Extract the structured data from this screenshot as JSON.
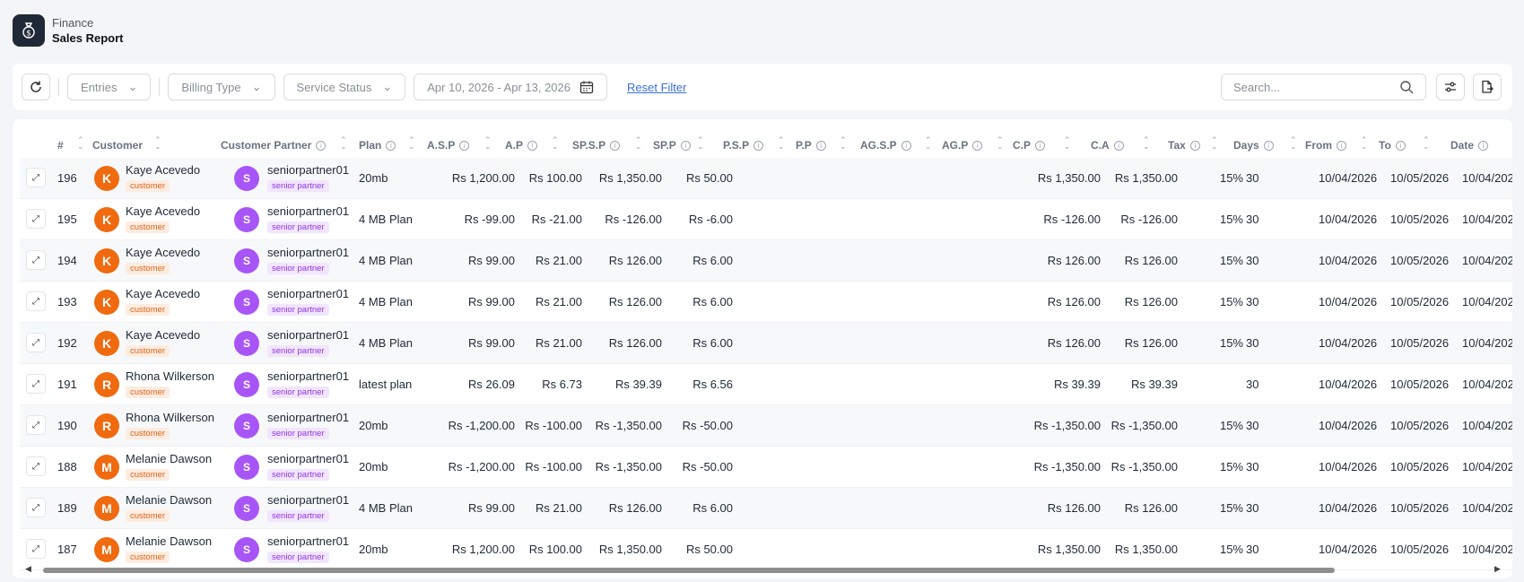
{
  "header": {
    "section": "Finance",
    "title": "Sales Report",
    "icon": "money-bag-icon"
  },
  "toolbar": {
    "entries": "Entries",
    "billing_type": "Billing Type",
    "service_status": "Service Status",
    "date_range": "Apr 10, 2026 - Apr 13, 2026",
    "reset": "Reset Filter",
    "search_placeholder": "Search..."
  },
  "columns": [
    "#",
    "Customer",
    "Customer Partner",
    "Plan",
    "A.S.P",
    "A.P",
    "SP.S.P",
    "SP.P",
    "P.S.P",
    "P.P",
    "AG.S.P",
    "AG.P",
    "C.P",
    "C.A",
    "Tax",
    "Days",
    "From",
    "To",
    "Date"
  ],
  "rows": [
    {
      "num": "196",
      "avatar": "K",
      "customer": "Kaye Acevedo",
      "ctype": "customer",
      "pavatar": "S",
      "partner": "seniorpartner01",
      "ptype": "senior partner",
      "plan": "20mb",
      "asp": "Rs 1,200.00",
      "ap": "Rs 100.00",
      "spsp": "Rs 1,350.00",
      "spp": "Rs 50.00",
      "cp": "Rs 1,350.00",
      "ca": "Rs 1,350.00",
      "tax": "15%",
      "days": "30",
      "from": "10/04/2026",
      "to": "10/05/2026",
      "date": "10/04/202"
    },
    {
      "num": "195",
      "avatar": "K",
      "customer": "Kaye Acevedo",
      "ctype": "customer",
      "pavatar": "S",
      "partner": "seniorpartner01",
      "ptype": "senior partner",
      "plan": "4 MB Plan",
      "asp": "Rs -99.00",
      "ap": "Rs -21.00",
      "spsp": "Rs -126.00",
      "spp": "Rs -6.00",
      "cp": "Rs -126.00",
      "ca": "Rs -126.00",
      "tax": "15%",
      "days": "30",
      "from": "10/04/2026",
      "to": "10/05/2026",
      "date": "10/04/202"
    },
    {
      "num": "194",
      "avatar": "K",
      "customer": "Kaye Acevedo",
      "ctype": "customer",
      "pavatar": "S",
      "partner": "seniorpartner01",
      "ptype": "senior partner",
      "plan": "4 MB Plan",
      "asp": "Rs 99.00",
      "ap": "Rs 21.00",
      "spsp": "Rs 126.00",
      "spp": "Rs 6.00",
      "cp": "Rs 126.00",
      "ca": "Rs 126.00",
      "tax": "15%",
      "days": "30",
      "from": "10/04/2026",
      "to": "10/05/2026",
      "date": "10/04/202"
    },
    {
      "num": "193",
      "avatar": "K",
      "customer": "Kaye Acevedo",
      "ctype": "customer",
      "pavatar": "S",
      "partner": "seniorpartner01",
      "ptype": "senior partner",
      "plan": "4 MB Plan",
      "asp": "Rs 99.00",
      "ap": "Rs 21.00",
      "spsp": "Rs 126.00",
      "spp": "Rs 6.00",
      "cp": "Rs 126.00",
      "ca": "Rs 126.00",
      "tax": "15%",
      "days": "30",
      "from": "10/04/2026",
      "to": "10/05/2026",
      "date": "10/04/202"
    },
    {
      "num": "192",
      "avatar": "K",
      "customer": "Kaye Acevedo",
      "ctype": "customer",
      "pavatar": "S",
      "partner": "seniorpartner01",
      "ptype": "senior partner",
      "plan": "4 MB Plan",
      "asp": "Rs 99.00",
      "ap": "Rs 21.00",
      "spsp": "Rs 126.00",
      "spp": "Rs 6.00",
      "cp": "Rs 126.00",
      "ca": "Rs 126.00",
      "tax": "15%",
      "days": "30",
      "from": "10/04/2026",
      "to": "10/05/2026",
      "date": "10/04/202"
    },
    {
      "num": "191",
      "avatar": "R",
      "customer": "Rhona Wilkerson",
      "ctype": "customer",
      "pavatar": "S",
      "partner": "seniorpartner01",
      "ptype": "senior partner",
      "plan": "latest plan",
      "asp": "Rs 26.09",
      "ap": "Rs 6.73",
      "spsp": "Rs 39.39",
      "spp": "Rs 6.56",
      "cp": "Rs 39.39",
      "ca": "Rs 39.39",
      "tax": "",
      "days": "30",
      "from": "10/04/2026",
      "to": "10/05/2026",
      "date": "10/04/202"
    },
    {
      "num": "190",
      "avatar": "R",
      "customer": "Rhona Wilkerson",
      "ctype": "customer",
      "pavatar": "S",
      "partner": "seniorpartner01",
      "ptype": "senior partner",
      "plan": "20mb",
      "asp": "Rs -1,200.00",
      "ap": "Rs -100.00",
      "spsp": "Rs -1,350.00",
      "spp": "Rs -50.00",
      "cp": "Rs -1,350.00",
      "ca": "Rs -1,350.00",
      "tax": "15%",
      "days": "30",
      "from": "10/04/2026",
      "to": "10/05/2026",
      "date": "10/04/202"
    },
    {
      "num": "188",
      "avatar": "M",
      "customer": "Melanie Dawson",
      "ctype": "customer",
      "pavatar": "S",
      "partner": "seniorpartner01",
      "ptype": "senior partner",
      "plan": "20mb",
      "asp": "Rs -1,200.00",
      "ap": "Rs -100.00",
      "spsp": "Rs -1,350.00",
      "spp": "Rs -50.00",
      "cp": "Rs -1,350.00",
      "ca": "Rs -1,350.00",
      "tax": "15%",
      "days": "30",
      "from": "10/04/2026",
      "to": "10/05/2026",
      "date": "10/04/202"
    },
    {
      "num": "189",
      "avatar": "M",
      "customer": "Melanie Dawson",
      "ctype": "customer",
      "pavatar": "S",
      "partner": "seniorpartner01",
      "ptype": "senior partner",
      "plan": "4 MB Plan",
      "asp": "Rs 99.00",
      "ap": "Rs 21.00",
      "spsp": "Rs 126.00",
      "spp": "Rs 6.00",
      "cp": "Rs 126.00",
      "ca": "Rs 126.00",
      "tax": "15%",
      "days": "30",
      "from": "10/04/2026",
      "to": "10/05/2026",
      "date": "10/04/202"
    },
    {
      "num": "187",
      "avatar": "M",
      "customer": "Melanie Dawson",
      "ctype": "customer",
      "pavatar": "S",
      "partner": "seniorpartner01",
      "ptype": "senior partner",
      "plan": "20mb",
      "asp": "Rs 1,200.00",
      "ap": "Rs 100.00",
      "spsp": "Rs 1,350.00",
      "spp": "Rs 50.00",
      "cp": "Rs 1,350.00",
      "ca": "Rs 1,350.00",
      "tax": "15%",
      "days": "30",
      "from": "10/04/2026",
      "to": "10/05/2026",
      "date": "10/04/202"
    }
  ]
}
